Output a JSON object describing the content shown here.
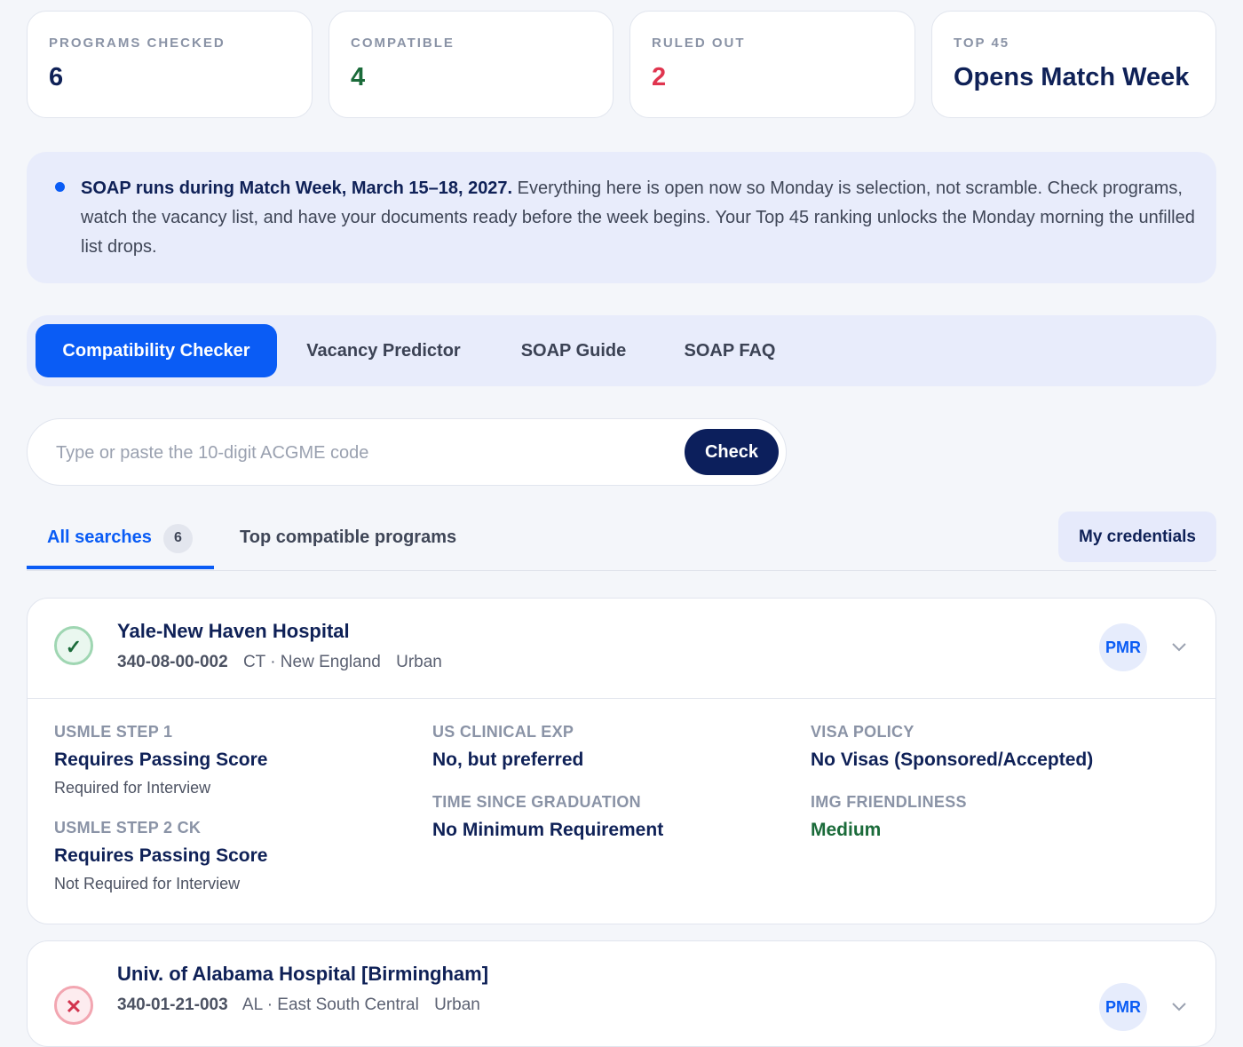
{
  "stats": [
    {
      "label": "PROGRAMS CHECKED",
      "value": "6",
      "color": "#0f2157"
    },
    {
      "label": "COMPATIBLE",
      "value": "4",
      "color": "#1b6b3a"
    },
    {
      "label": "RULED OUT",
      "value": "2",
      "color": "#e0354f"
    },
    {
      "label": "TOP 45",
      "value": "Opens Match Week",
      "color": "#0f2157"
    }
  ],
  "notice": {
    "bold": "SOAP runs during Match Week, March 15–18, 2027.",
    "text": " Everything here is open now so Monday is selection, not scramble. Check programs, watch the vacancy list, and have your documents ready before the week begins. Your Top 45 ranking unlocks the Monday morning the unfilled list drops."
  },
  "tabs": [
    "Compatibility Checker",
    "Vacancy Predictor",
    "SOAP Guide",
    "SOAP FAQ"
  ],
  "search": {
    "placeholder": "Type or paste the 10-digit ACGME code",
    "button": "Check"
  },
  "subtabs": {
    "all": "All searches",
    "all_count": "6",
    "top": "Top compatible programs",
    "credentials": "My credentials"
  },
  "programs": [
    {
      "name": "Yale-New Haven Hospital",
      "code": "340-08-00-002",
      "region": "CT · New England",
      "setting": "Urban",
      "specialty": "PMR",
      "status": "compatible",
      "status_icon": "✓",
      "fields": {
        "step1": {
          "label": "USMLE STEP 1",
          "value": "Requires Passing Score",
          "note": "Required for Interview"
        },
        "step2": {
          "label": "USMLE STEP 2 CK",
          "value": "Requires Passing Score",
          "note": "Not Required for Interview"
        },
        "usce": {
          "label": "US CLINICAL EXP",
          "value": "No, but preferred"
        },
        "yog": {
          "label": "TIME SINCE GRADUATION",
          "value": "No Minimum Requirement"
        },
        "visa": {
          "label": "VISA POLICY",
          "value": "No Visas (Sponsored/Accepted)"
        },
        "img": {
          "label": "IMG FRIENDLINESS",
          "value": "Medium"
        }
      }
    },
    {
      "name": "Univ. of Alabama Hospital [Birmingham]",
      "code": "340-01-21-003",
      "region": "AL · East South Central",
      "setting": "Urban",
      "specialty": "PMR",
      "status": "ruled-out",
      "status_icon": "✕"
    }
  ]
}
